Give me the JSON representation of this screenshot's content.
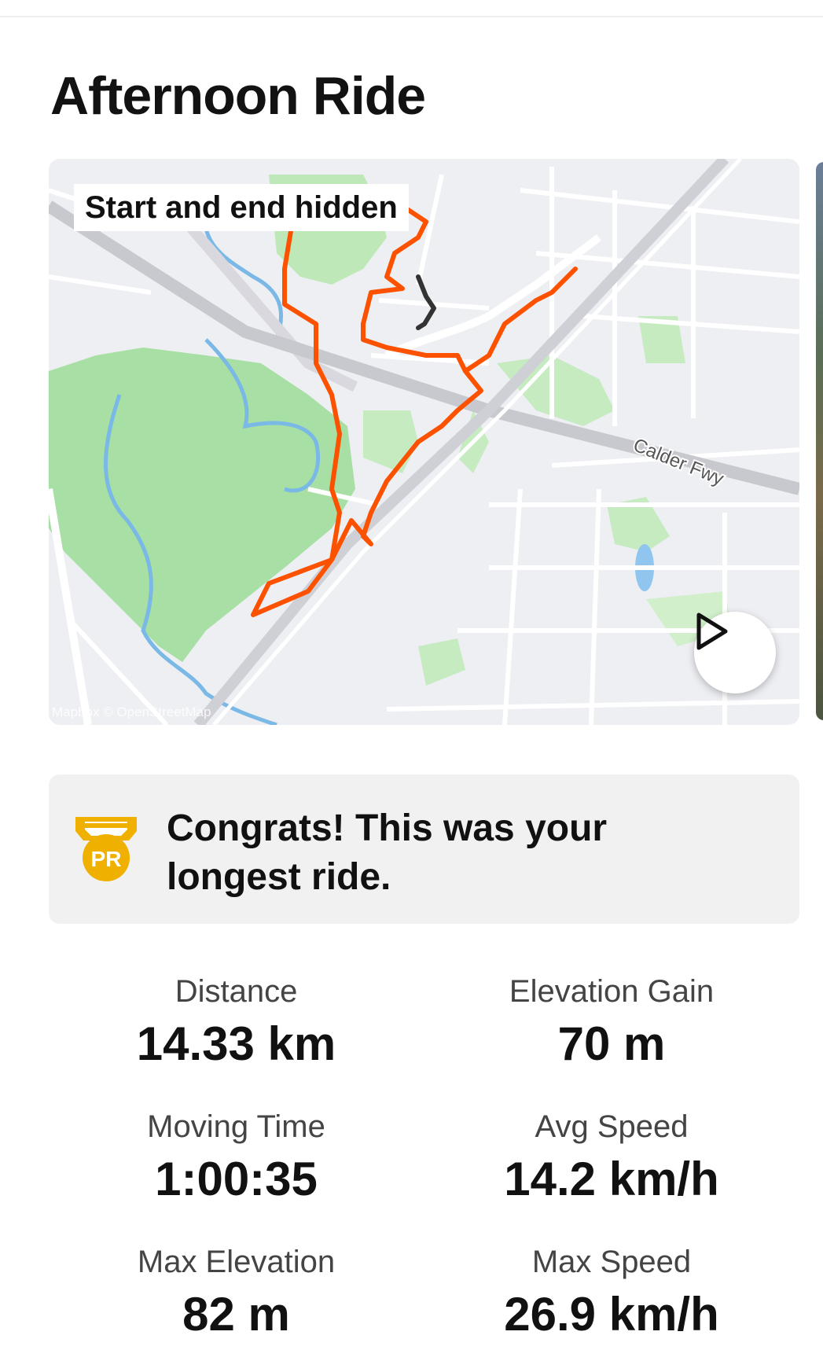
{
  "activity": {
    "title": "Afternoon Ride"
  },
  "map": {
    "privacy_label": "Start and end hidden",
    "road_label": "Calder Fwy",
    "attribution": "Mapbox © OpenStreetMap",
    "play_icon": "play-icon",
    "route_color": "#fc5200",
    "hidden_segment_color": "#333333"
  },
  "achievement": {
    "badge_text": "PR",
    "badge_icon": "pr-medal-icon",
    "badge_color": "#f0b000",
    "message": "Congrats! This was your longest ride."
  },
  "stats": [
    {
      "label": "Distance",
      "value": "14.33 km"
    },
    {
      "label": "Elevation Gain",
      "value": "70 m"
    },
    {
      "label": "Moving Time",
      "value": "1:00:35"
    },
    {
      "label": "Avg Speed",
      "value": "14.2 km/h"
    },
    {
      "label": "Max Elevation",
      "value": "82 m"
    },
    {
      "label": "Max Speed",
      "value": "26.9 km/h"
    }
  ]
}
